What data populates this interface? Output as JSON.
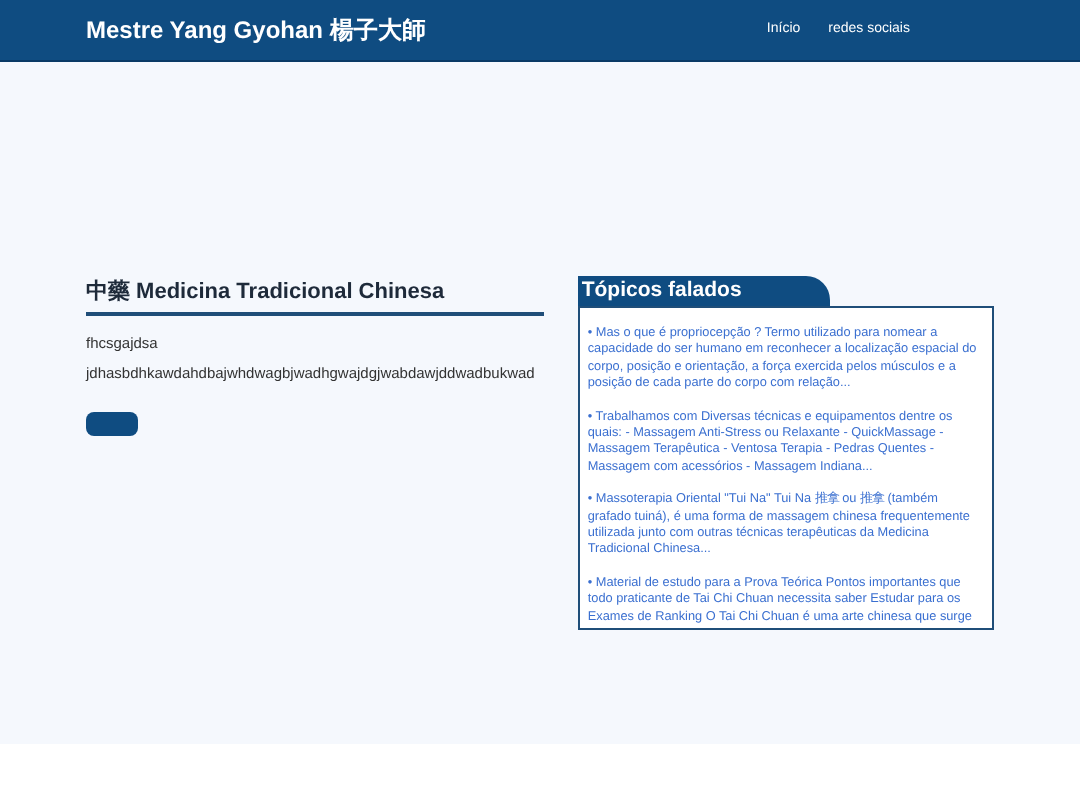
{
  "header": {
    "title": "Mestre Yang Gyohan 楊子大師",
    "nav": [
      "Início",
      "redes sociais"
    ]
  },
  "main": {
    "heading": "中藥 Medicina Tradicional Chinesa",
    "lines": [
      "fhcsgajdsa",
      "jdhasbdhkawdahdbajwhdwagbjwadhgwajdgjwabdawjddwadbukwad"
    ]
  },
  "topics": {
    "title": "Tópicos falados",
    "items": [
      "• Mas o que é propriocepção ? Termo utilizado para nomear a capacidade do ser humano em reconhecer a localização espacial do corpo, posição e orientação, a força exercida pelos músculos e a posição de cada parte do corpo com relação...",
      "• Trabalhamos com Diversas técnicas e equipamentos dentre os quais: - Massagem Anti-Stress ou Relaxante - QuickMassage - Massagem Terapêutica - Ventosa Terapia - Pedras Quentes - Massagem com acessórios - Massagem Indiana...",
      "• Massoterapia Oriental \"Tui Na\" Tui Na 推拿 ou 推拿 (também grafado tuiná), é uma forma de massagem chinesa frequentemente utilizada junto com outras técnicas terapêuticas da Medicina Tradicional Chinesa...",
      "• Material de estudo para a Prova Teórica Pontos importantes que todo praticante de Tai Chi Chuan necessita saber Estudar para os Exames de Ranking O Tai Chi Chuan é uma arte chinesa que surge"
    ]
  }
}
